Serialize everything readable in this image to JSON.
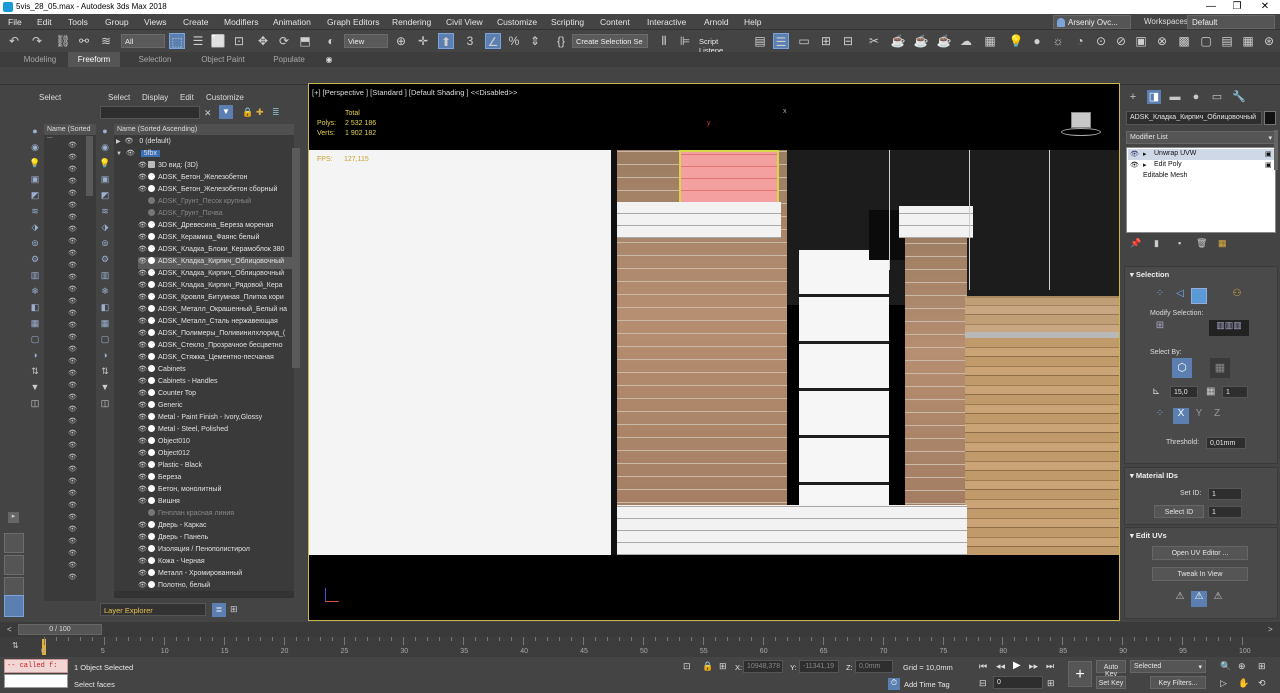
{
  "window": {
    "title": "5vis_28_05.max - Autodesk 3ds Max 2018",
    "min": "—",
    "max": "❐",
    "close": "✕"
  },
  "menu": [
    "File",
    "Edit",
    "Tools",
    "Group",
    "Views",
    "Create",
    "Modifiers",
    "Animation",
    "Graph Editors",
    "Rendering",
    "Civil View",
    "Customize",
    "Scripting",
    "Content",
    "Interactive",
    "Arnold",
    "Help"
  ],
  "user": {
    "name": "Arseniy Ovc...",
    "workspaces_label": "Workspaces:",
    "workspace": "Default"
  },
  "toolbar": {
    "filter": "All",
    "ref_coord": "View",
    "selection_set": "Create Selection Se",
    "script_listener": "Script Listene"
  },
  "ribbon_tabs": [
    "Modeling",
    "Freeform",
    "Selection",
    "Object Paint",
    "Populate"
  ],
  "scene_explorer_1": {
    "menu": [
      "Select"
    ],
    "column": "Name (Sorted ..."
  },
  "scene_explorer_2": {
    "menu": [
      "Select",
      "Display",
      "Edit",
      "Customize"
    ],
    "column": "Name (Sorted Ascending)",
    "layers": [
      "0 (default)",
      "5fbx"
    ],
    "items": [
      "3D вид: {3D}",
      "ADSK_Бетон_Железобетон",
      "ADSK_Бетон_Железобетон сборный",
      "ADSK_Грунт_Песок крупный",
      "ADSK_Грунт_Почва",
      "ADSK_Древесина_Береза мореная",
      "ADSK_Керамика_Фаянс белый",
      "ADSK_Кладка_Блоки_Керамоблок 380",
      "ADSK_Кладка_Кирпич_Облицовочный",
      "ADSK_Кладка_Кирпич_Облицовочный",
      "ADSK_Кладка_Кирпич_Рядовой_Кера",
      "ADSK_Кровля_Битумная_Плитка кори",
      "ADSK_Металл_Окрашенный_Белый на",
      "ADSK_Металл_Сталь нержавеющая",
      "ADSK_Полимеры_Поливинилхлорид_(",
      "ADSK_Стекло_Прозрачное бесцветно",
      "ADSK_Стяжка_Цементно-песчаная",
      "Cabinets",
      "Cabinets - Handles",
      "Counter Top",
      "Generic",
      "Metal - Paint Finish - Ivory,Glossy",
      "Metal - Steel, Polished",
      "Object010",
      "Object012",
      "Plastic - Black",
      "Береза",
      "Бетон, монолитный",
      "Вишня",
      "Генплан красная линия",
      "Дверь - Каркас",
      "Дверь - Панель",
      "Изоляция / Пенополистирол",
      "Кожа - Черная",
      "Металл - Хромированный",
      "Полотно, белый"
    ],
    "footer": "Layer Explorer"
  },
  "viewport": {
    "label": "[+] [Perspective ] [Standard ] [Default Shading ]  <<Disabled>>",
    "stats_header": "Total",
    "polys_label": "Polys:",
    "polys": "2 532 186",
    "verts_label": "Verts:",
    "verts": "1 902 182",
    "fps_label": "FPS:",
    "fps": "127,115",
    "axis_y": "y",
    "axis_x": "x"
  },
  "command_panel": {
    "object_name": "ADSK_Кладка_Кирпич_Облицовочный",
    "modifier_list": "Modifier List",
    "stack": [
      "Unwrap UVW",
      "Edit Poly",
      "Editable Mesh"
    ],
    "selection": {
      "title": "Selection",
      "modify_selection": "Modify Selection:",
      "select_by": "Select By:",
      "angle": "15,0",
      "threshold_label": "Threshold:",
      "threshold": "0,01mm",
      "x": "X",
      "y": "Y",
      "z": "Z"
    },
    "material_ids": {
      "title": "Material IDs",
      "set_id_label": "Set ID:",
      "set_id": "1",
      "select_id_label": "Select ID",
      "select_id": "1"
    },
    "edit_uvs": {
      "title": "Edit UVs",
      "open_editor": "Open UV Editor ...",
      "tweak": "Tweak In View"
    }
  },
  "timeline": {
    "frame": "0 / 100",
    "ticks": [
      "0",
      "5",
      "10",
      "15",
      "20",
      "25",
      "30",
      "35",
      "40",
      "45",
      "50",
      "55",
      "60",
      "65",
      "70",
      "75",
      "80",
      "85",
      "90",
      "95",
      "100"
    ],
    "current_frame": 0
  },
  "status": {
    "script_box": "-- called f:",
    "selected": "1 Object Selected",
    "prompt": "Select faces",
    "x_label": "X:",
    "x": "10948,378",
    "y_label": "Y:",
    "y": "-11341,19",
    "z_label": "Z:",
    "z": "0,0mm",
    "grid": "Grid = 10,0mm",
    "add_time_tag": "Add Time Tag",
    "auto_key": "Auto Key",
    "set_key": "Set Key",
    "selected_dd": "Selected",
    "key_filters": "Key Filters...",
    "frame_field": "0"
  }
}
